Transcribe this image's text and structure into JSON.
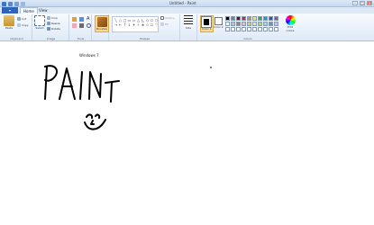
{
  "titlebar": {
    "title": "Untitled - Paint"
  },
  "tabs": {
    "file": "▾",
    "home": "Home",
    "view": "View"
  },
  "clipboard": {
    "paste": "Paste",
    "cut": "Cut",
    "copy": "Copy",
    "label": "Clipboard"
  },
  "image": {
    "select": "Select",
    "crop": "Crop",
    "resize": "Resize",
    "rotate": "Rotate",
    "label": "Image"
  },
  "tools": {
    "label": "Tools",
    "text_glyph": "A"
  },
  "brushes": {
    "label": "Brushes"
  },
  "shapes": {
    "outline": "Outline",
    "fill": "Fill",
    "label": "Shapes",
    "glyphs": [
      "╲",
      "○",
      "□",
      "▭",
      "▱",
      "△",
      "◺",
      "◇",
      "⬠",
      "⬡",
      "→",
      "←",
      "↑",
      "↓",
      "✦",
      "✧",
      "★",
      "✩",
      "☐",
      "♡"
    ]
  },
  "size": {
    "label": "Size"
  },
  "colors": {
    "color1": "Color 1",
    "color2": "Color 2",
    "edit": "Edit colors",
    "label": "Colors",
    "swatches": [
      "#000000",
      "#7f7f7f",
      "#880015",
      "#ed1c24",
      "#ff7f27",
      "#fff200",
      "#22b14c",
      "#00a2e8",
      "#3f48cc",
      "#a349a4",
      "#ffffff",
      "#c3c3c3",
      "#b97a57",
      "#ffaec9",
      "#ffc90e",
      "#efe4b0",
      "#b5e61d",
      "#99d9ea",
      "#7092be",
      "#c8bfe7",
      "#ffffff",
      "#ffffff",
      "#ffffff",
      "#ffffff",
      "#ffffff",
      "#ffffff",
      "#ffffff",
      "#ffffff",
      "#ffffff",
      "#ffffff"
    ]
  },
  "canvas": {
    "caption": "Windows 7"
  }
}
